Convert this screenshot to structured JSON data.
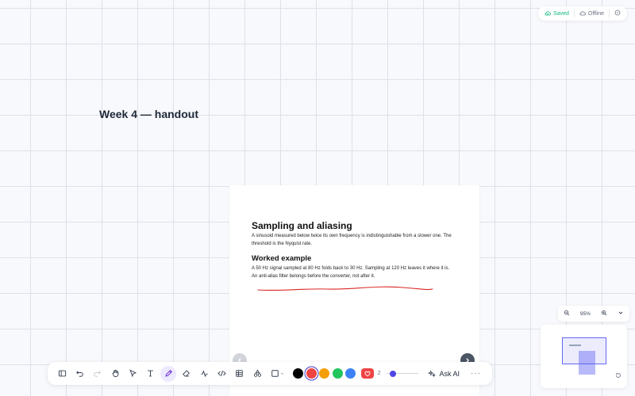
{
  "status": {
    "saved": "Saved",
    "offline": "Offline"
  },
  "canvas": {
    "title": "Week 4 — handout"
  },
  "page": {
    "heading": "Sampling and aliasing",
    "intro": "A sinusoid measured below twice its own frequency is indistinguishable from a slower one. The threshold is the Nyquist rate.",
    "subheading": "Worked example",
    "example": "A 50 Hz signal sampled at 80 Hz folds back to 30 Hz. Sampling at 120 Hz leaves it where it is.",
    "note": "An anti-alias filter belongs before the converter, not after it."
  },
  "toolbar": {
    "tools": [
      "sidebar-toggle",
      "undo",
      "redo",
      "hand",
      "select",
      "text",
      "pen",
      "eraser",
      "shape-line",
      "code",
      "table",
      "shapes",
      "rectangle"
    ],
    "colors": [
      "#000000",
      "#ef4444",
      "#f59e0b",
      "#22c55e",
      "#3b82f6"
    ],
    "selected_color": "#ef4444",
    "stroke_width": "2",
    "stroke_fraction": 0.1,
    "ask_ai_label": "Ask AI",
    "more_label": "···"
  },
  "zoom": {
    "level": "95%"
  },
  "colors": {
    "accent": "#4f46e5",
    "ink": "#dc2626",
    "saved": "#10b981"
  }
}
